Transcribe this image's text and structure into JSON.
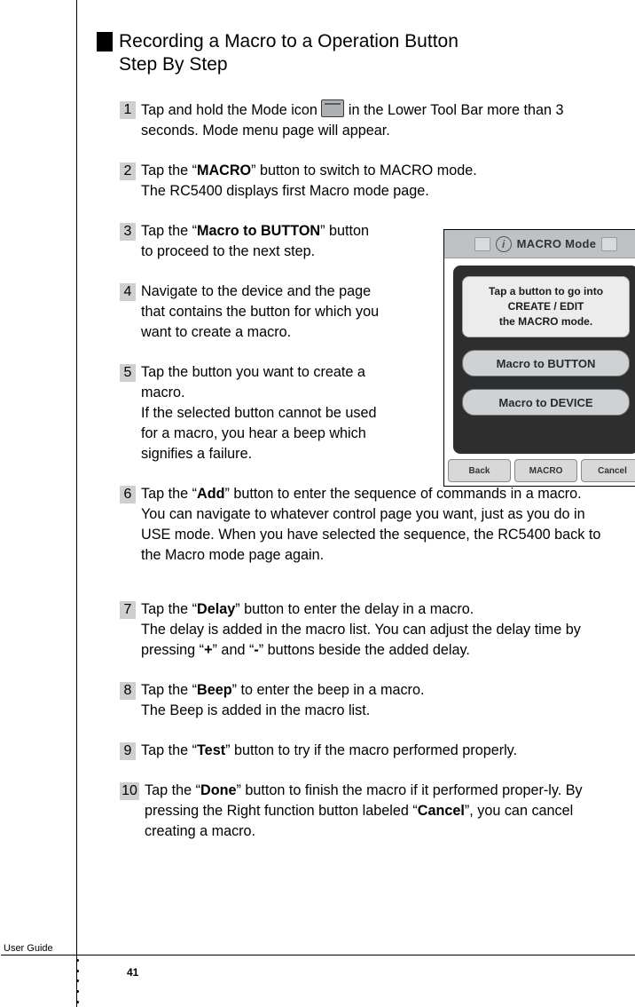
{
  "title": {
    "line1": "Recording a Macro to a Operation Button",
    "line2": "Step By Step"
  },
  "steps": [
    {
      "num": "1",
      "parts": [
        {
          "t": "Tap and hold the Mode icon "
        },
        {
          "icon": "mode-icon"
        },
        {
          "t": " in the Lower Tool Bar more than 3 seconds. Mode menu page will appear."
        }
      ]
    },
    {
      "num": "2",
      "parts": [
        {
          "t": "Tap the “"
        },
        {
          "b": "MACRO"
        },
        {
          "t": "” button to switch to MACRO mode."
        },
        {
          "br": true
        },
        {
          "t": "The RC5400 displays first Macro mode page."
        }
      ]
    },
    {
      "num": "3",
      "narrow": true,
      "parts": [
        {
          "t": "Tap the “"
        },
        {
          "b": "Macro to BUTTON"
        },
        {
          "t": "” button to proceed to the next step."
        }
      ]
    },
    {
      "num": "4",
      "narrow": true,
      "parts": [
        {
          "t": "Navigate to the device and the page that contains the button for which you want  to create a macro."
        }
      ]
    },
    {
      "num": "5",
      "narrow": true,
      "parts": [
        {
          "t": "Tap the button you want to create a macro."
        },
        {
          "br": true
        },
        {
          "t": "If the selected button cannot be used for a macro, you hear a beep which signifies a failure."
        }
      ]
    },
    {
      "num": "6",
      "parts": [
        {
          "t": "Tap the “"
        },
        {
          "b": "Add"
        },
        {
          "t": "” button to enter the sequence of commands in a macro."
        },
        {
          "br": true
        },
        {
          "t": "You can navigate to whatever control page you want, just as you do in USE mode. When you have selected the sequence, the RC5400 back to the Macro mode page again."
        }
      ]
    },
    {
      "num": "7",
      "gapBefore": true,
      "parts": [
        {
          "t": "Tap the “"
        },
        {
          "b": "Delay"
        },
        {
          "t": "” button to enter the delay in a macro."
        },
        {
          "br": true
        },
        {
          "t": "The delay is added in the macro list. You can adjust the delay time by pressing “"
        },
        {
          "b": "+"
        },
        {
          "t": "” and “"
        },
        {
          "b": "-"
        },
        {
          "t": "” buttons beside the added delay."
        }
      ]
    },
    {
      "num": "8",
      "parts": [
        {
          "t": "Tap the “"
        },
        {
          "b": "Beep"
        },
        {
          "t": "” to enter the beep in a macro."
        },
        {
          "br": true
        },
        {
          "t": "The Beep is added in the macro list."
        }
      ]
    },
    {
      "num": "9",
      "parts": [
        {
          "t": "Tap the “"
        },
        {
          "b": "Test"
        },
        {
          "t": "” button to try if the macro performed properly."
        }
      ]
    },
    {
      "num": "10",
      "wideNum": true,
      "parts": [
        {
          "t": "Tap the “"
        },
        {
          "b": "Done"
        },
        {
          "t": "” button to finish the macro if it performed proper-ly. By pressing the Right function button labeled “"
        },
        {
          "b": "Cancel"
        },
        {
          "t": "”, you can cancel creating a macro."
        }
      ]
    }
  ],
  "device": {
    "title": "MACRO Mode",
    "message": "Tap a button to go into\nCREATE / EDIT\nthe MACRO mode.",
    "buttons": [
      "Macro to BUTTON",
      "Macro to DEVICE"
    ],
    "soft": [
      "Back",
      "MACRO",
      "Cancel"
    ]
  },
  "footer": {
    "label": "User Guide",
    "pageNum": "41"
  }
}
